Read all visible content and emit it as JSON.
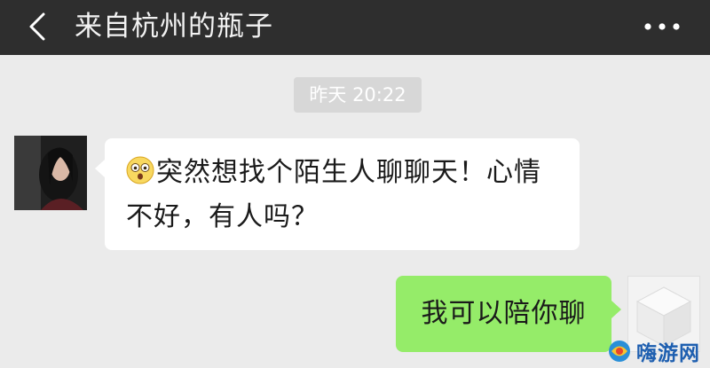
{
  "header": {
    "title": "来自杭州的瓶子"
  },
  "chat": {
    "timestamp": "昨天 20:22",
    "messages": [
      {
        "side": "left",
        "text": "突然想找个陌生人聊聊天！心情不好，有人吗？",
        "prefix_icon": "astonished-face-emoji"
      },
      {
        "side": "right",
        "text": "我可以陪你聊"
      }
    ]
  },
  "watermark": {
    "text": "嗨游网"
  },
  "colors": {
    "header_bg": "#2e2e2e",
    "chat_bg": "#ebebeb",
    "incoming_bubble": "#ffffff",
    "outgoing_bubble": "#95ec69",
    "timestamp_bg": "#d7d7d7"
  }
}
